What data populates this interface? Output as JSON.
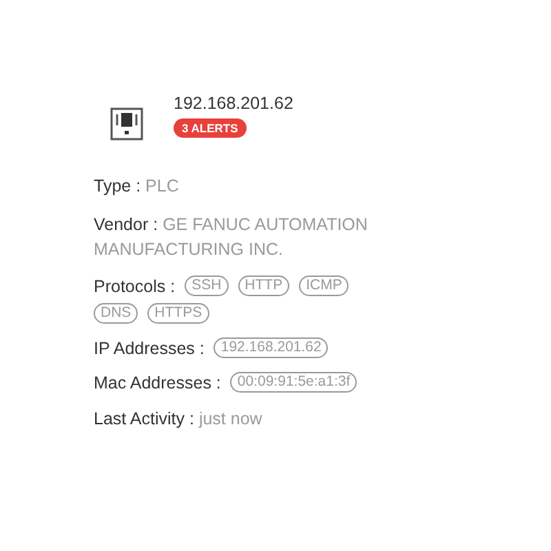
{
  "device": {
    "title": "192.168.201.62",
    "alerts": "3 ALERTS"
  },
  "fields": [
    {
      "kind": "text",
      "label": "Type :",
      "value": "PLC"
    },
    {
      "kind": "text",
      "label": "Vendor :",
      "value": "GE FANUC AUTOMATION MANUFACTURING INC."
    },
    {
      "kind": "chips",
      "label": "Protocols :",
      "chips": [
        "SSH",
        "HTTP",
        "ICMP",
        "DNS",
        "HTTPS"
      ]
    },
    {
      "kind": "chips",
      "label": "IP Addresses :",
      "chips": [
        "192.168.201.62"
      ]
    },
    {
      "kind": "chips",
      "label": "Mac Addresses :",
      "chips": [
        "00:09:91:5e:a1:3f"
      ]
    },
    {
      "kind": "text",
      "label": "Last Activity :",
      "value": "just now"
    }
  ]
}
